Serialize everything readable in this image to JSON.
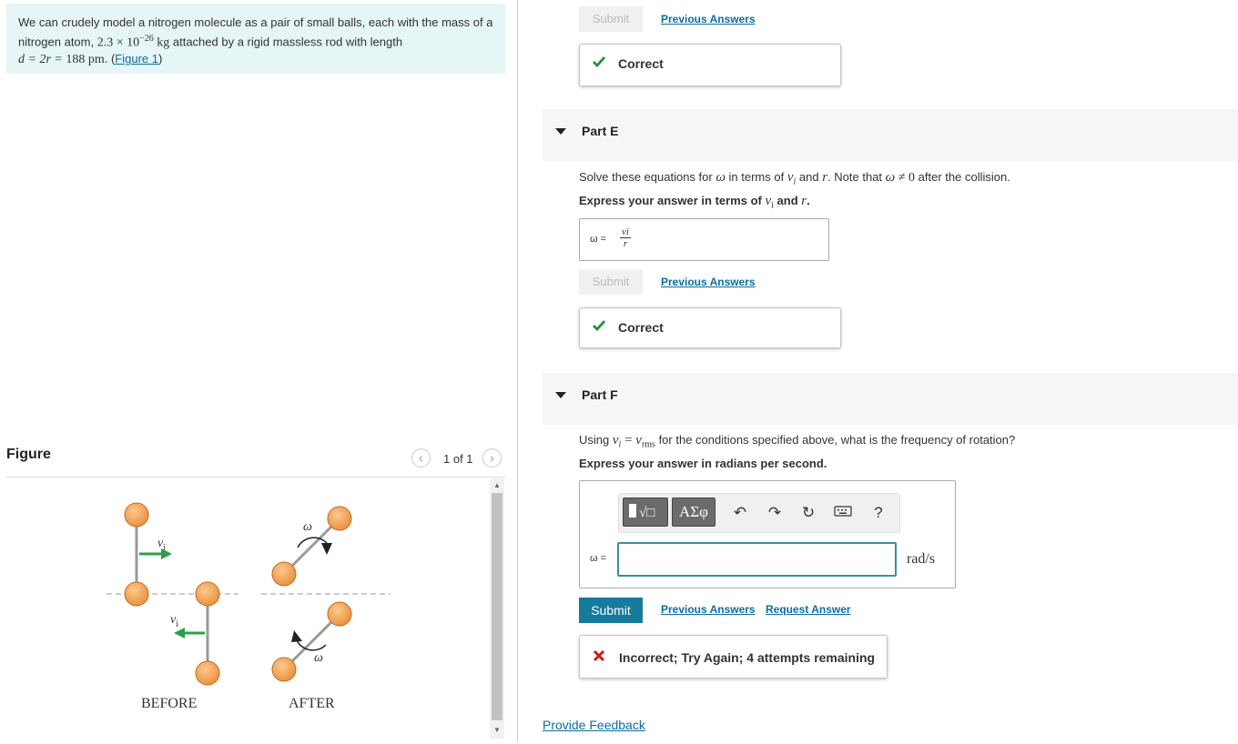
{
  "intro": {
    "text_prefix": "We can crudely model a nitrogen molecule as a pair of small balls, each with the mass of a nitrogen atom, ",
    "mass": "2.3 × 10",
    "mass_exp": "−26",
    "mass_unit": "kg",
    "text_mid": " attached by a rigid massless rod with length ",
    "length_eq": "d = 2r = ",
    "length_val": "188 pm",
    "figure_link": "Figure 1"
  },
  "figure": {
    "title": "Figure",
    "counter": "1 of 1",
    "prev_icon": "chevron-left-icon",
    "next_icon": "chevron-right-icon",
    "labels": {
      "before": "BEFORE",
      "after": "AFTER",
      "v": "v",
      "v_sub": "i",
      "omega": "ω"
    },
    "colors": {
      "ball": "#f0a050",
      "ball_stroke": "#c06a20",
      "rod": "#999999",
      "arrow": "#2aa04a"
    }
  },
  "partD_tail": {
    "submit": "Submit",
    "prev_answers": "Previous Answers",
    "feedback": "Correct"
  },
  "partE": {
    "label": "Part E",
    "question_a": "Solve these equations for ",
    "question_b": " in terms of ",
    "question_c": " and ",
    "question_d": ". Note that ",
    "question_e": " after the collision.",
    "omega": "ω",
    "vi": "v",
    "vi_sub": "i",
    "r": "r",
    "neq": "≠ 0",
    "express_a": "Express your answer in terms of ",
    "express_b": " and ",
    "express_c": ".",
    "answer_lhs": "ω =",
    "answer_num": "vi",
    "answer_den": "r",
    "submit": "Submit",
    "prev_answers": "Previous Answers",
    "feedback": "Correct"
  },
  "partF": {
    "label": "Part F",
    "question_a": "Using ",
    "eq_lhs": "v",
    "eq_lhs_sub": "i",
    "eq_rhs": "v",
    "eq_rhs_sub": "rms",
    "question_b": " for the conditions specified above, what is the frequency of rotation?",
    "express": "Express your answer in radians per second.",
    "toolbar": {
      "templates_icon": "templates-icon",
      "greek": "ΑΣφ",
      "undo_icon": "undo-icon",
      "redo_icon": "redo-icon",
      "reset_icon": "reset-icon",
      "keyboard_icon": "keyboard-icon",
      "help": "?"
    },
    "answer_lhs": "ω =",
    "answer_value": "",
    "units": "rad/s",
    "submit": "Submit",
    "prev_answers": "Previous Answers",
    "request_answer": "Request Answer",
    "feedback": "Incorrect; Try Again; 4 attempts remaining"
  },
  "footer": {
    "provide_feedback": "Provide Feedback"
  },
  "colors": {
    "accent": "#157a9b",
    "link": "#0b6ea1",
    "correct": "#2a8a3a",
    "incorrect": "#cc1b1b",
    "intro_bg": "#e6f5f6"
  }
}
